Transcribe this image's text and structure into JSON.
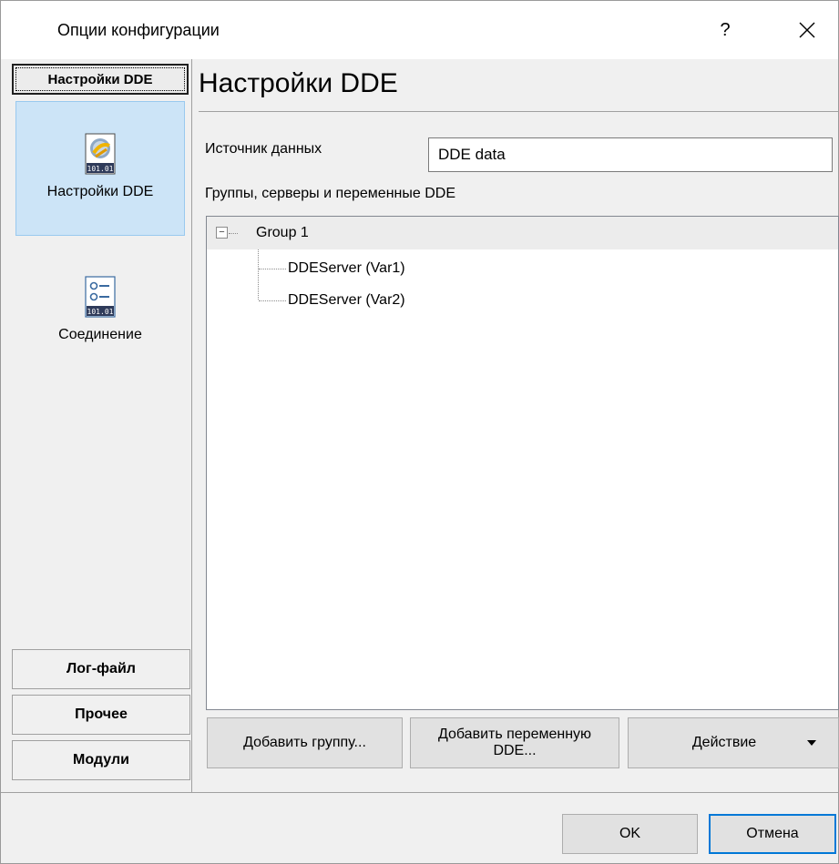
{
  "window": {
    "title": "Опции конфигурации",
    "help_label": "?",
    "close_icon": "close-icon"
  },
  "sidebar": {
    "group_header": "Настройки DDE",
    "items": [
      {
        "label": "Настройки DDE",
        "icon": "dde-settings-icon",
        "selected": true
      },
      {
        "label": "Соединение",
        "icon": "connection-icon",
        "selected": false
      }
    ],
    "bottom_groups": [
      "Лог-файл",
      "Прочее",
      "Модули"
    ]
  },
  "main": {
    "title": "Настройки DDE",
    "source_label": "Источник данных",
    "source_value": "DDE data",
    "tree_label": "Группы, серверы и переменные DDE",
    "tree": {
      "group_expander": "−",
      "group": "Group 1",
      "children": [
        "DDEServer (Var1)",
        "DDEServer (Var2)"
      ]
    },
    "buttons": {
      "add_group": "Добавить группу...",
      "add_variable": "Добавить переменную DDE...",
      "action": "Действие"
    }
  },
  "footer": {
    "ok": "OK",
    "cancel": "Отмена"
  },
  "colors": {
    "selection_bg": "#cce4f7",
    "default_button_border": "#0078d7"
  }
}
